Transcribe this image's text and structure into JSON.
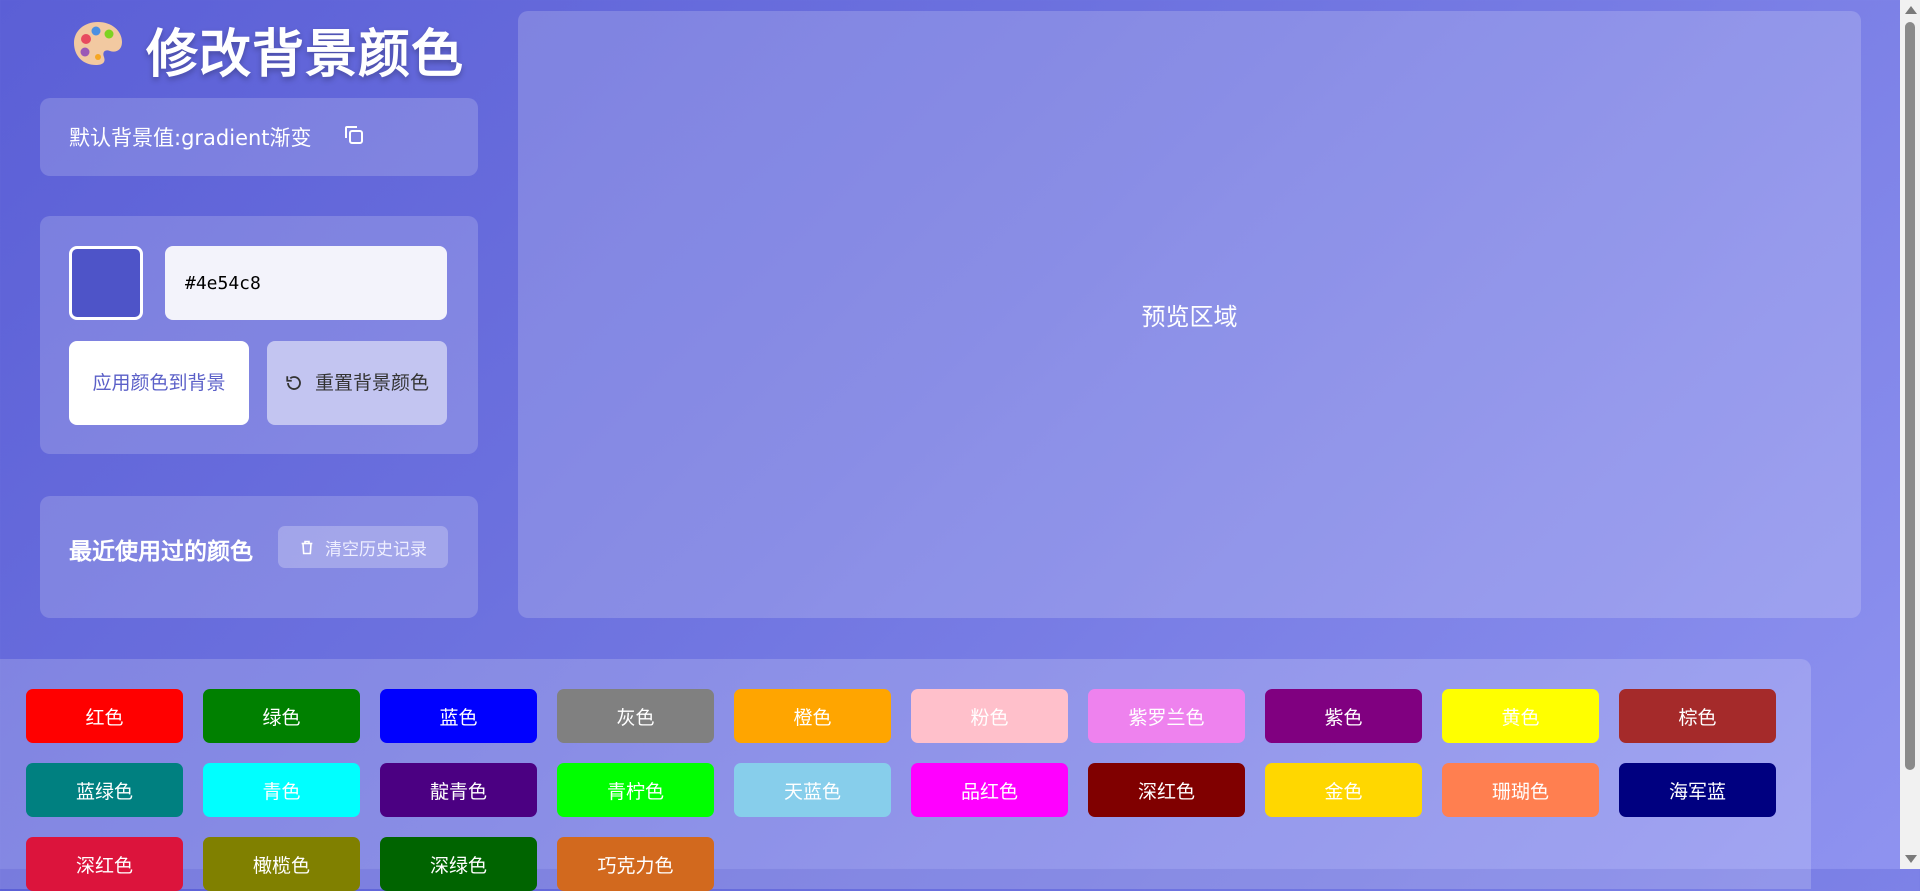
{
  "header": {
    "icon": "palette-icon",
    "title": "修改背景颜色"
  },
  "default_bg": {
    "text": "默认背景值:gradient渐变",
    "copy_icon": "copy-icon"
  },
  "picker": {
    "swatch_color": "#4e54c8",
    "hex_value": "#4e54c8",
    "apply_label": "应用颜色到背景",
    "reset_label": "重置背景颜色",
    "reset_icon": "reset-icon"
  },
  "history": {
    "title": "最近使用过的颜色",
    "clear_label": "清空历史记录",
    "clear_icon": "trash-icon"
  },
  "preview": {
    "label": "预览区域"
  },
  "palette": [
    {
      "label": "红色",
      "color": "#ff0000"
    },
    {
      "label": "绿色",
      "color": "#008000"
    },
    {
      "label": "蓝色",
      "color": "#0000ff"
    },
    {
      "label": "灰色",
      "color": "#808080"
    },
    {
      "label": "橙色",
      "color": "#ffa500"
    },
    {
      "label": "粉色",
      "color": "#ffc0cb"
    },
    {
      "label": "紫罗兰色",
      "color": "#ee82ee"
    },
    {
      "label": "紫色",
      "color": "#800080"
    },
    {
      "label": "黄色",
      "color": "#ffff00"
    },
    {
      "label": "棕色",
      "color": "#a52a2a"
    },
    {
      "label": "蓝绿色",
      "color": "#008080"
    },
    {
      "label": "青色",
      "color": "#00ffff"
    },
    {
      "label": "靛青色",
      "color": "#4b0082"
    },
    {
      "label": "青柠色",
      "color": "#00ff00"
    },
    {
      "label": "天蓝色",
      "color": "#87ceeb"
    },
    {
      "label": "品红色",
      "color": "#ff00ff"
    },
    {
      "label": "深红色",
      "color": "#800000"
    },
    {
      "label": "金色",
      "color": "#ffd700"
    },
    {
      "label": "珊瑚色",
      "color": "#ff7f50"
    },
    {
      "label": "海军蓝",
      "color": "#000080"
    },
    {
      "label": "深红色",
      "color": "#dc143c"
    },
    {
      "label": "橄榄色",
      "color": "#808000"
    },
    {
      "label": "深绿色",
      "color": "#006400"
    },
    {
      "label": "巧克力色",
      "color": "#d2691e"
    }
  ]
}
